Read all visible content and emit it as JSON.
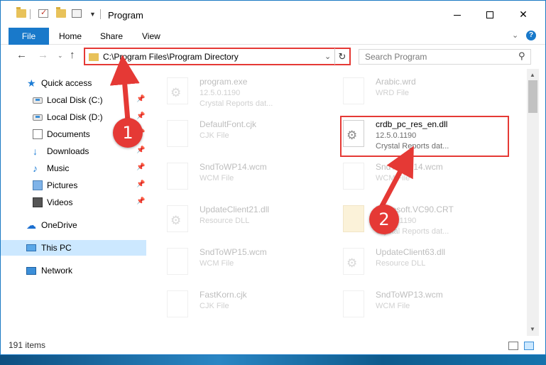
{
  "window": {
    "title": "Program",
    "controls": {
      "minimize": "minimize",
      "maximize": "maximize",
      "close": "✕"
    }
  },
  "ribbon": {
    "tabs": [
      "File",
      "Home",
      "Share",
      "View"
    ],
    "expand_glyph": "⌄",
    "help_glyph": "?"
  },
  "navigation": {
    "back_glyph": "←",
    "forward_glyph": "→",
    "up_glyph": "↑",
    "recent_glyph": "⌄",
    "address_path": "C:\\Program Files\\Program Directory",
    "address_dropdown_glyph": "⌄",
    "refresh_glyph": "↻",
    "search_placeholder": "Search Program",
    "search_glyph": "⚲"
  },
  "sidebar": {
    "items": [
      {
        "label": "Quick access",
        "icon": "star-icon",
        "pinned": false
      },
      {
        "label": "Local Disk (C:)",
        "icon": "disk-icon",
        "pinned": true
      },
      {
        "label": "Local Disk (D:)",
        "icon": "disk-icon",
        "pinned": true
      },
      {
        "label": "Documents",
        "icon": "documents-icon",
        "pinned": true
      },
      {
        "label": "Downloads",
        "icon": "downloads-icon",
        "pinned": true
      },
      {
        "label": "Music",
        "icon": "music-icon",
        "pinned": true
      },
      {
        "label": "Pictures",
        "icon": "pictures-icon",
        "pinned": true
      },
      {
        "label": "Videos",
        "icon": "videos-icon",
        "pinned": true
      },
      {
        "label": "OneDrive",
        "icon": "onedrive-icon",
        "pinned": false
      },
      {
        "label": "This PC",
        "icon": "this-pc-icon",
        "pinned": false,
        "selected": true
      },
      {
        "label": "Network",
        "icon": "network-icon",
        "pinned": false
      }
    ],
    "pin_glyph": "📌"
  },
  "files": [
    {
      "name": "program.exe",
      "line1": "12.5.0.1190",
      "line2": "Crystal Reports dat...",
      "highlighted": false
    },
    {
      "name": "Arabic.wrd",
      "line1": "WRD File",
      "line2": "",
      "highlighted": false
    },
    {
      "name": "DefaultFont.cjk",
      "line1": "CJK File",
      "line2": "",
      "highlighted": false
    },
    {
      "name": "crdb_pc_res_en.dll",
      "line1": "12.5.0.1190",
      "line2": "Crystal Reports dat...",
      "highlighted": true
    },
    {
      "name": "SndToWP14.wcm",
      "line1": "WCM File",
      "line2": "",
      "highlighted": false
    },
    {
      "name": "SndToWP14.wcm",
      "line1": "WCM File",
      "line2": "",
      "highlighted": false
    },
    {
      "name": "UpdateClient21.dll",
      "line1": "Resource DLL",
      "line2": "",
      "highlighted": false
    },
    {
      "name": "Microsoft.VC90.CRT",
      "line1": "12.5.0.1190",
      "line2": "Crystal Reports dat...",
      "highlighted": false
    },
    {
      "name": "SndToWP15.wcm",
      "line1": "WCM File",
      "line2": "",
      "highlighted": false
    },
    {
      "name": "UpdateClient63.dll",
      "line1": "Resource DLL",
      "line2": "",
      "highlighted": false
    },
    {
      "name": "FastKorn.cjk",
      "line1": "CJK File",
      "line2": "",
      "highlighted": false
    },
    {
      "name": "SndToWP13.wcm",
      "line1": "WCM File",
      "line2": "",
      "highlighted": false
    }
  ],
  "statusbar": {
    "item_count": "191 items"
  },
  "annotations": {
    "badge1": "1",
    "badge2": "2",
    "color": "#e53935"
  }
}
